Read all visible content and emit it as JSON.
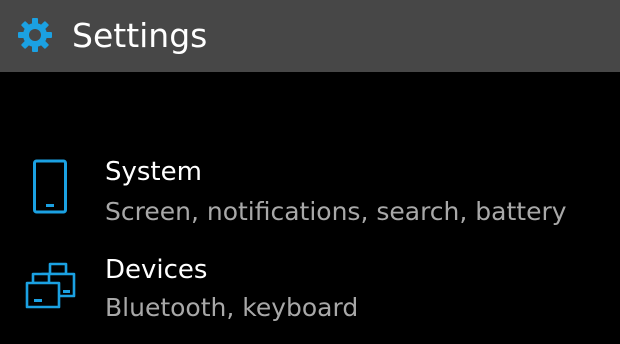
{
  "header": {
    "icon": "gear-icon",
    "title": "Settings"
  },
  "items": [
    {
      "icon": "phone-icon",
      "title": "System",
      "subtitle": "Screen, notifications, search, battery"
    },
    {
      "icon": "devices-icon",
      "title": "Devices",
      "subtitle": "Bluetooth, keyboard"
    }
  ],
  "colors": {
    "accent": "#1ba1e2",
    "header_bg": "#474747",
    "background": "#000000",
    "title_text": "#ffffff",
    "subtitle_text": "#a8a8a8"
  }
}
